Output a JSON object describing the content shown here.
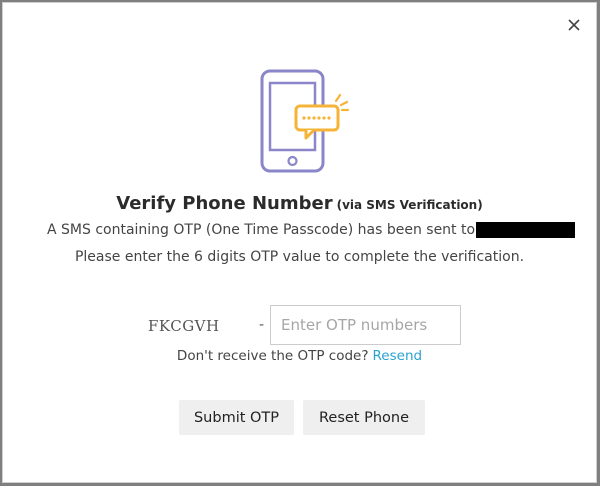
{
  "dialog": {
    "close_label": "×",
    "title": "Verify Phone Number",
    "title_note": "(via SMS Verification)",
    "message_line1": "A SMS containing OTP (One Time Passcode) has been sent to",
    "message_line2": "Please enter the 6 digits OTP value to complete the verification.",
    "captcha_code": "FKCGVH",
    "separator": "-",
    "otp_input": {
      "value": "",
      "placeholder": "Enter OTP numbers"
    },
    "resend_prompt": "Don't receive the OTP code?",
    "resend_link": "Resend",
    "buttons": {
      "submit": "Submit OTP",
      "reset": "Reset Phone"
    },
    "icons": {
      "close": "close-icon",
      "illustration": "phone-sms-icon"
    },
    "colors": {
      "phone_outline": "#8a86c9",
      "bubble": "#f5b437",
      "link": "#2aa3cf",
      "button_bg": "#efefef"
    }
  }
}
